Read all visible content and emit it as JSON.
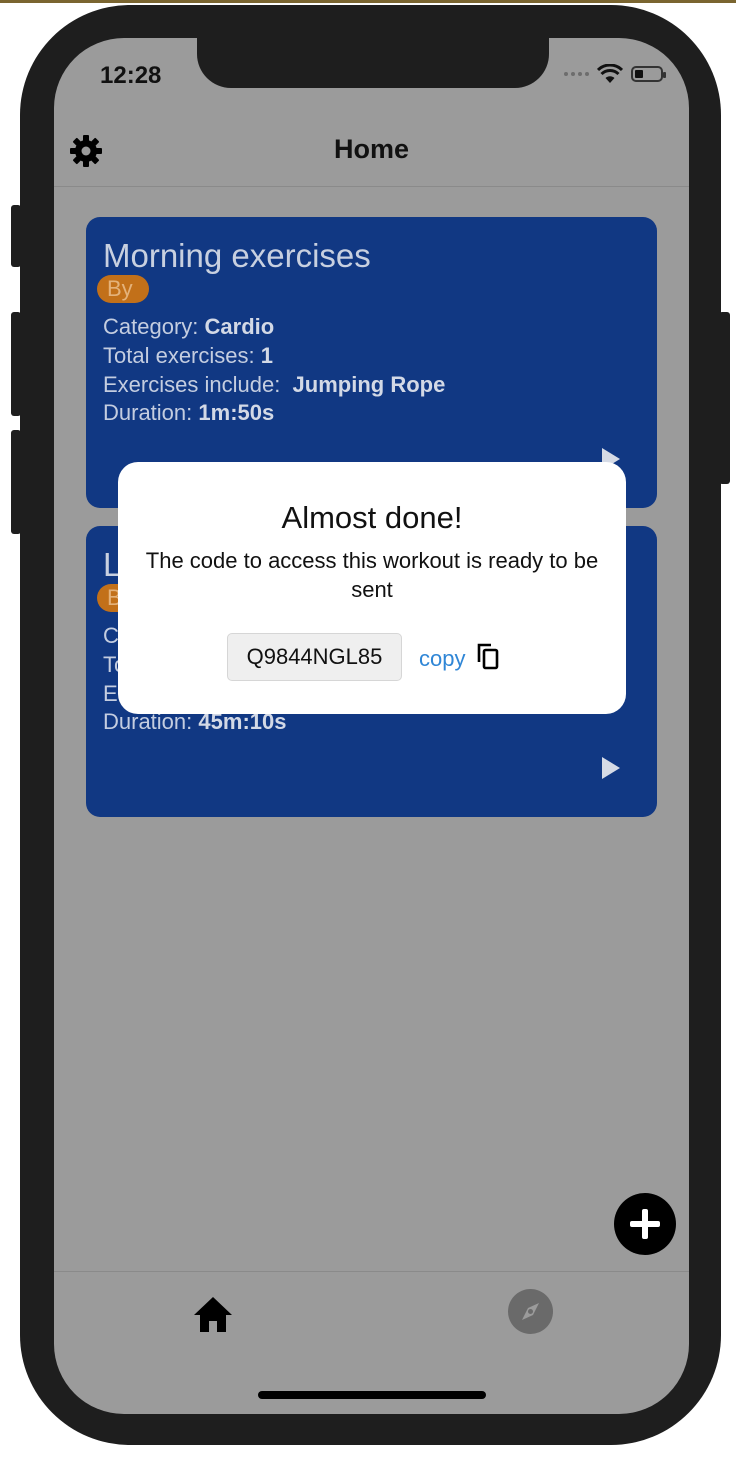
{
  "status_bar": {
    "time": "12:28"
  },
  "header": {
    "title": "Home"
  },
  "workouts": [
    {
      "title": "Morning exercises",
      "by_label": "By",
      "category_label": "Category:",
      "category_value": "Cardio",
      "total_label": "Total exercises:",
      "total_value": "1",
      "includes_label": "Exercises include:",
      "includes_value": "Jumping Rope",
      "duration_label": "Duration:",
      "duration_value": "1m:50s"
    },
    {
      "title": "L",
      "by_label": "B",
      "line1": "C",
      "line2": "To",
      "line3": "E",
      "duration_label": "Duration:",
      "duration_value": "45m:10s"
    }
  ],
  "modal": {
    "title": "Almost done!",
    "message": "The code to access this workout is ready to be sent",
    "code": "Q9844NGL85",
    "copy_label": "copy"
  },
  "tabbar": {
    "items": [
      "home-icon",
      "compass-icon"
    ]
  },
  "colors": {
    "card_bg": "#113883",
    "badge_bg": "#c27019",
    "overlay_bg": "#9b9b9b",
    "link": "#2f86d6"
  }
}
